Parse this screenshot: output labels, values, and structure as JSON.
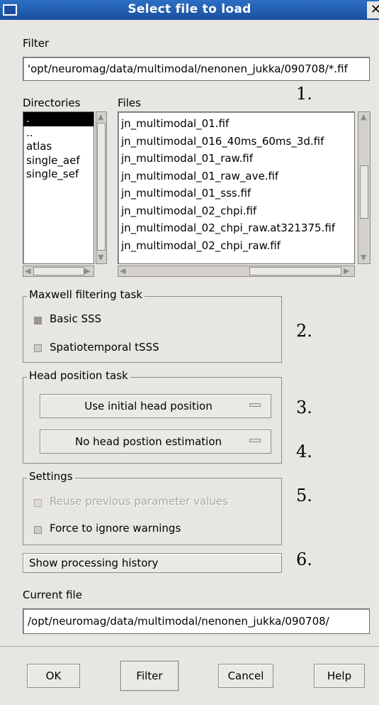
{
  "window": {
    "title": "Select file to load",
    "close_glyph": "✕"
  },
  "filter": {
    "label": "Filter",
    "value": "'opt/neuromag/data/multimodal/nenonen_jukka/090708/*.fif"
  },
  "directories": {
    "label": "Directories",
    "items": [
      ".",
      "..",
      "atlas",
      "single_aef",
      "single_sef"
    ],
    "selected_index": 0
  },
  "files": {
    "label": "Files",
    "items": [
      "jn_multimodal_01.fif",
      "jn_multimodal_016_40ms_60ms_3d.fif",
      "jn_multimodal_01_raw.fif",
      "jn_multimodal_01_raw_ave.fif",
      "jn_multimodal_01_sss.fif",
      "jn_multimodal_02_chpi.fif",
      "jn_multimodal_02_chpi_raw.at321375.fif",
      "jn_multimodal_02_chpi_raw.fif"
    ]
  },
  "annotations": {
    "n1": "1.",
    "n2": "2.",
    "n3": "3.",
    "n4": "4.",
    "n5": "5.",
    "n6": "6."
  },
  "maxwell": {
    "title": "Maxwell filtering task",
    "basic_sss": {
      "label": "Basic SSS",
      "checked": true
    },
    "tsss": {
      "label": "Spatiotemporal tSSS",
      "checked": false
    }
  },
  "head_position": {
    "title": "Head position task",
    "initial_option": "Use initial head position",
    "estimation_option": "No head postion estimation"
  },
  "settings": {
    "title": "Settings",
    "reuse": {
      "label": "Reuse previous parameter values",
      "enabled": false
    },
    "force": {
      "label": "Force to ignore warnings",
      "checked": false
    }
  },
  "history_button": "Show processing history",
  "current_file": {
    "label": "Current file",
    "value": "/opt/neuromag/data/multimodal/nenonen_jukka/090708/"
  },
  "buttons": {
    "ok": "OK",
    "filter": "Filter",
    "cancel": "Cancel",
    "help": "Help"
  },
  "icons": {
    "scroll_up": "up-arrow-icon",
    "scroll_down": "down-arrow-icon",
    "scroll_left": "left-arrow-icon",
    "scroll_right": "right-arrow-icon"
  }
}
